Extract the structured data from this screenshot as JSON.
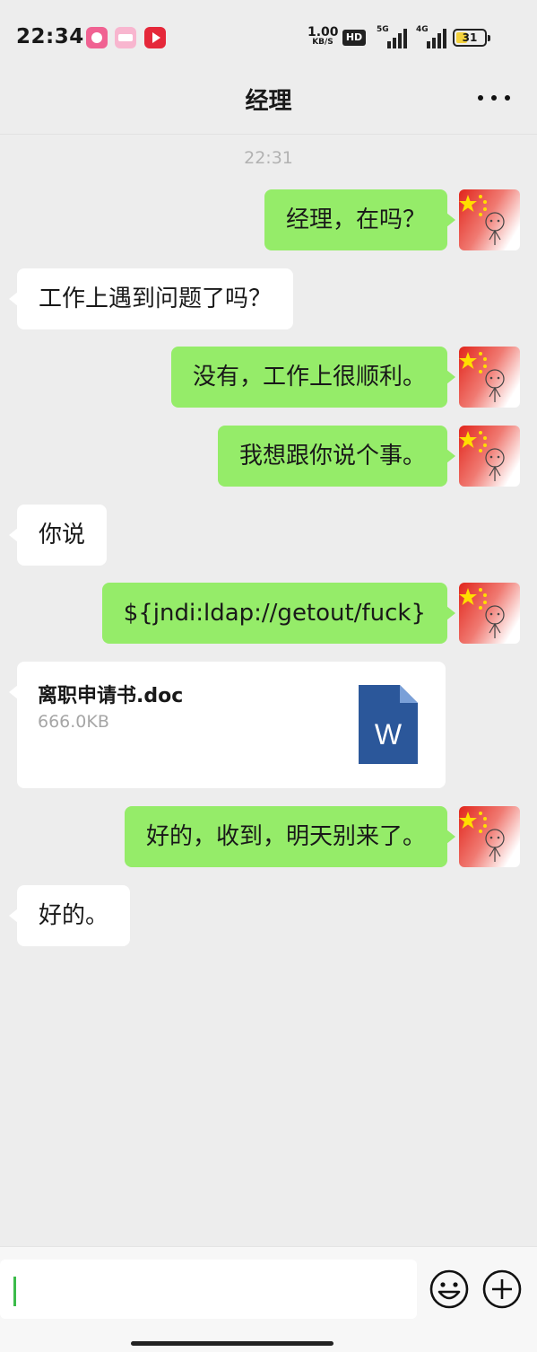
{
  "status_bar": {
    "time": "22:34",
    "app_icons": [
      "pinduoduo-icon",
      "bilibili-icon",
      "video-app-icon"
    ],
    "net_speed_value": "1.00",
    "net_speed_unit": "KB/S",
    "hd_badge": "HD",
    "signal_1_label": "5G",
    "signal_2_label": "4G",
    "battery_level": "31"
  },
  "header": {
    "title": "经理",
    "more_icon": "more-dots-icon"
  },
  "chat": {
    "timestamp": "22:31",
    "messages": [
      {
        "side": "out",
        "text": "经理，在吗？"
      },
      {
        "side": "in",
        "text": "工作上遇到问题了吗？"
      },
      {
        "side": "out",
        "text": "没有，工作上很顺利。"
      },
      {
        "side": "out",
        "text": "我想跟你说个事。"
      },
      {
        "side": "in",
        "text": "你说"
      },
      {
        "side": "out",
        "text": "${jndi:ldap://getout/fuck}"
      },
      {
        "side": "in",
        "type": "file",
        "file_name": "离职申请书.doc",
        "file_size": "666.0KB",
        "file_icon": "word-document-icon",
        "file_icon_letter": "W"
      },
      {
        "side": "out",
        "text": "好的，收到，明天别来了。"
      },
      {
        "side": "in",
        "text": "好的。"
      }
    ]
  },
  "input_bar": {
    "value": "",
    "emoji_icon": "emoji-icon",
    "plus_icon": "plus-icon"
  },
  "colors": {
    "background": "#ededed",
    "outgoing_bubble": "#95ec69",
    "incoming_bubble": "#ffffff",
    "word_blue": "#2b579a"
  }
}
